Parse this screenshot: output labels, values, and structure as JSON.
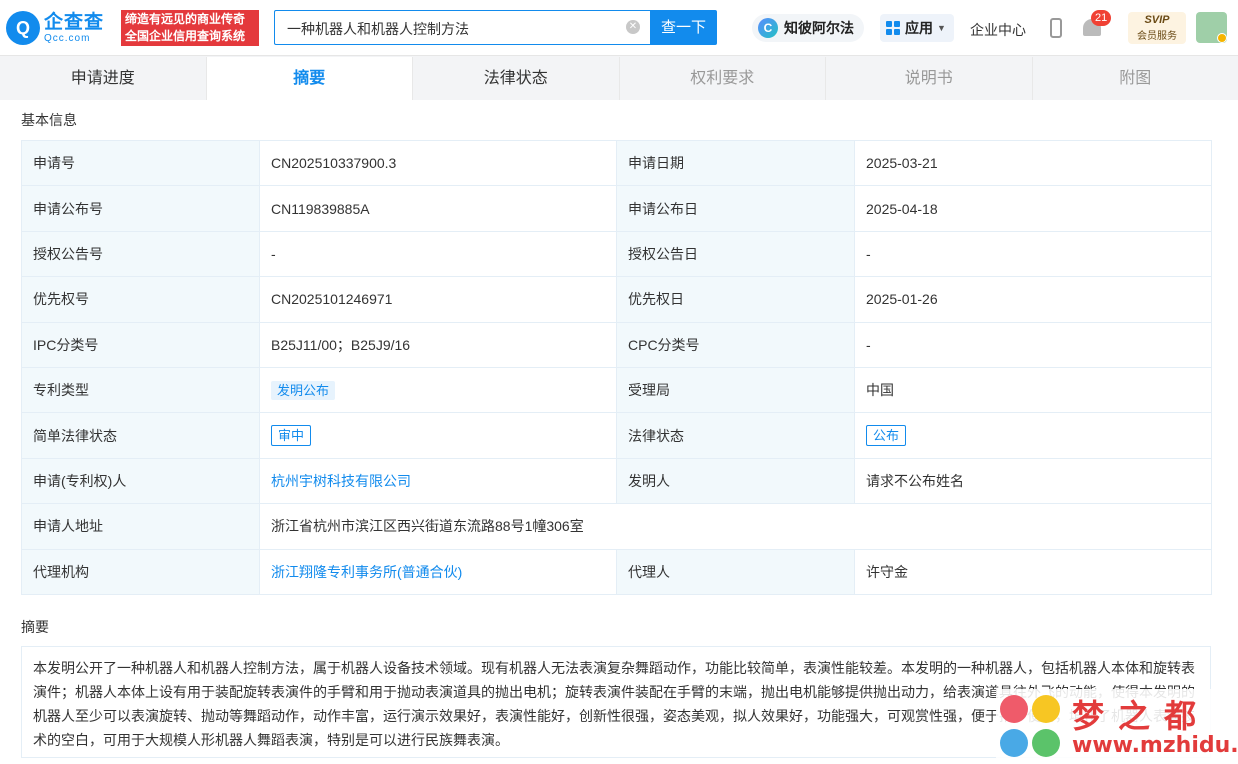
{
  "header": {
    "logo_cn": "企查查",
    "logo_en": "Qcc.com",
    "slogan_line1": "缔造有远见的商业传奇",
    "slogan_line2": "全国企业信用查询系统",
    "search_value": "一种机器人和机器人控制方法",
    "search_button": "查一下",
    "zhibi_label": "知彼阿尔法",
    "app_label": "应用",
    "enterprise_center": "企业中心",
    "notification_count": "21",
    "svip_top": "SVIP",
    "svip_bottom": "会员服务"
  },
  "tabs": [
    {
      "label": "申请进度",
      "state": "normal"
    },
    {
      "label": "摘要",
      "state": "active"
    },
    {
      "label": "法律状态",
      "state": "normal"
    },
    {
      "label": "权利要求",
      "state": "dim"
    },
    {
      "label": "说明书",
      "state": "dim"
    },
    {
      "label": "附图",
      "state": "dim"
    }
  ],
  "basic_info": {
    "title": "基本信息",
    "rows": [
      {
        "l1": "申请号",
        "v1": "CN202510337900.3",
        "l2": "申请日期",
        "v2": "2025-03-21"
      },
      {
        "l1": "申请公布号",
        "v1": "CN119839885A",
        "l2": "申请公布日",
        "v2": "2025-04-18"
      },
      {
        "l1": "授权公告号",
        "v1": "-",
        "l2": "授权公告日",
        "v2": "-"
      },
      {
        "l1": "优先权号",
        "v1": "CN2025101246971",
        "l2": "优先权日",
        "v2": "2025-01-26"
      },
      {
        "l1": "IPC分类号",
        "v1": "B25J11/00；B25J9/16",
        "l2": "CPC分类号",
        "v2": "-"
      },
      {
        "l1": "专利类型",
        "v1": "发明公布",
        "l2": "受理局",
        "v2": "中国"
      },
      {
        "l1": "简单法律状态",
        "v1": "审中",
        "l2": "法律状态",
        "v2": "公布"
      },
      {
        "l1": "申请(专利权)人",
        "v1": "杭州宇树科技有限公司",
        "l2": "发明人",
        "v2": "请求不公布姓名"
      },
      {
        "l1": "申请人地址",
        "v1": "浙江省杭州市滨江区西兴街道东流路88号1幢306室"
      },
      {
        "l1": "代理机构",
        "v1": "浙江翔隆专利事务所(普通合伙)",
        "l2": "代理人",
        "v2": "许守金"
      }
    ]
  },
  "abstract": {
    "title": "摘要",
    "text": "本发明公开了一种机器人和机器人控制方法，属于机器人设备技术领域。现有机器人无法表演复杂舞蹈动作，功能比较简单，表演性能较差。本发明的一种机器人，包括机器人本体和旋转表演件；机器人本体上设有用于装配旋转表演件的手臂和用于抛动表演道具的抛出电机；旋转表演件装配在手臂的末端，抛出电机能够提供抛出动力，给表演道具往外飞的动能，使得本发明的机器人至少可以表演旋转、抛动等舞蹈动作，动作丰富，运行演示效果好，表演性能好，创新性很强，姿态美观，拟人效果好，功能强大，可观赏性强，便于推广使用，填补了机器人表演技术的空白，可用于大规模人形机器人舞蹈表演，特别是可以进行民族舞表演。"
  },
  "watermark": {
    "title": "梦之都",
    "url": "www.mzhidu.com"
  }
}
